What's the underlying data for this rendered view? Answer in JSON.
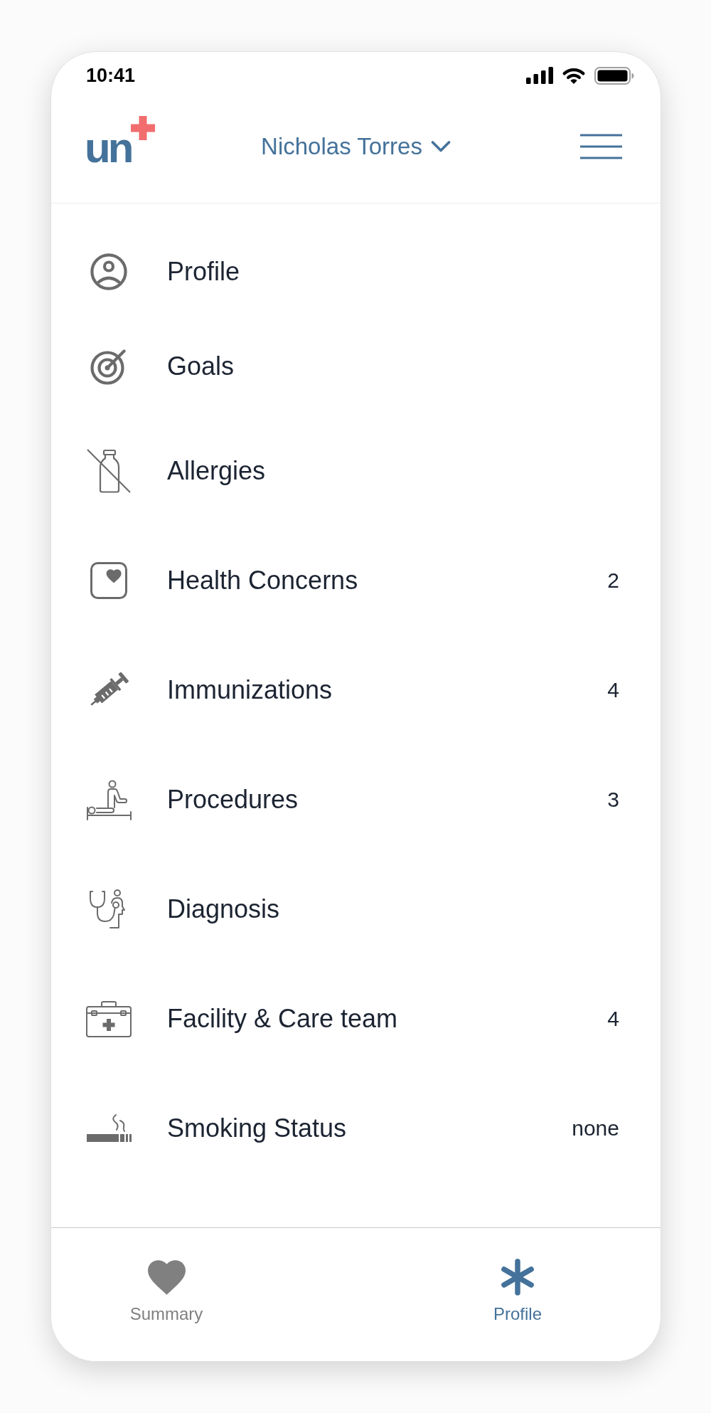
{
  "status_bar": {
    "time": "10:41"
  },
  "header": {
    "logo": {
      "text": "un"
    },
    "user_name": "Nicholas Torres"
  },
  "menu": [
    {
      "label": "Profile"
    },
    {
      "label": "Goals"
    },
    {
      "label": "Allergies"
    },
    {
      "label": "Health Concerns",
      "count": "2"
    },
    {
      "label": "Immunizations",
      "count": "4"
    },
    {
      "label": "Procedures",
      "count": "3"
    },
    {
      "label": "Diagnosis"
    },
    {
      "label": "Facility & Care team",
      "count": "4"
    },
    {
      "label": "Smoking Status",
      "count": "none"
    }
  ],
  "tab_bar": [
    {
      "label": "Summary",
      "selected": false
    },
    {
      "label": "Profile",
      "selected": true
    }
  ]
}
